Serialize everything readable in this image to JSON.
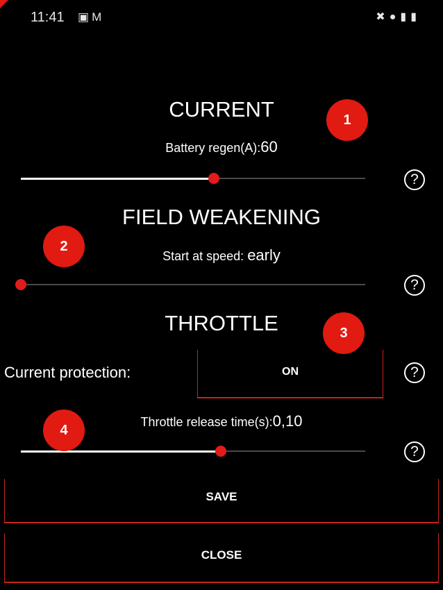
{
  "status_bar": {
    "time": "11:41",
    "left_icons": [
      "image-icon",
      "gmail-icon"
    ],
    "right_icons": [
      "mute-icon",
      "location-icon",
      "signal-icon",
      "battery-charging-icon"
    ]
  },
  "current": {
    "title": "CURRENT",
    "label": "Battery regen(A):",
    "value": "60",
    "slider_fraction": 0.56
  },
  "field_weakening": {
    "title": "FIELD WEAKENING",
    "label": "Start at speed: ",
    "value": "early",
    "slider_fraction": 0.0
  },
  "throttle": {
    "title": "THROTTLE",
    "protection_label": "Current protection:",
    "protection_value": "ON",
    "release_label": "Throttle release time(s):",
    "release_value": "0,10",
    "slider_fraction": 0.58
  },
  "help_symbol": "?",
  "badges": [
    "1",
    "2",
    "3",
    "4"
  ],
  "buttons": {
    "save": "SAVE",
    "close": "CLOSE"
  },
  "colors": {
    "accent": "#e21b1b",
    "background": "#000000",
    "text": "#ffffff"
  }
}
